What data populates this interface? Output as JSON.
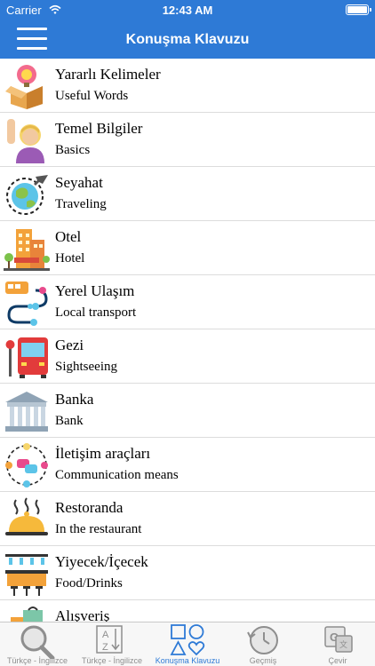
{
  "status_bar": {
    "carrier": "Carrier",
    "time": "12:43 AM"
  },
  "header": {
    "title": "Konuşma Klavuzu"
  },
  "categories": [
    {
      "title": "Yararlı Kelimeler",
      "subtitle": "Useful Words",
      "icon": "idea-box-icon"
    },
    {
      "title": "Temel Bilgiler",
      "subtitle": "Basics",
      "icon": "person-raising-hand-icon"
    },
    {
      "title": "Seyahat",
      "subtitle": "Traveling",
      "icon": "globe-airplane-icon"
    },
    {
      "title": "Otel",
      "subtitle": "Hotel",
      "icon": "hotel-building-icon"
    },
    {
      "title": "Yerel Ulaşım",
      "subtitle": "Local transport",
      "icon": "bus-route-icon"
    },
    {
      "title": "Gezi",
      "subtitle": "Sightseeing",
      "icon": "bus-stop-icon"
    },
    {
      "title": "Banka",
      "subtitle": "Bank",
      "icon": "bank-building-icon"
    },
    {
      "title": "İletişim araçları",
      "subtitle": "Communication means",
      "icon": "people-chat-icon"
    },
    {
      "title": "Restoranda",
      "subtitle": "In the restaurant",
      "icon": "food-cloche-icon"
    },
    {
      "title": "Yiyecek/İçecek",
      "subtitle": "Food/Drinks",
      "icon": "bar-counter-icon"
    },
    {
      "title": "Alışveriş",
      "subtitle": "",
      "icon": "shopping-bag-icon"
    }
  ],
  "tabs": [
    {
      "label": "Türkçe - İngilizce",
      "icon": "magnifier-icon"
    },
    {
      "label": "Türkçe - İngilizce",
      "icon": "sort-az-icon"
    },
    {
      "label": "Konuşma Klavuzu",
      "icon": "shapes-icon",
      "active": true
    },
    {
      "label": "Geçmiş",
      "icon": "history-clock-icon"
    },
    {
      "label": "Çevir",
      "icon": "translate-icon"
    }
  ],
  "colors": {
    "accent": "#2E7AD6",
    "tab_inactive": "#8E8E8E"
  }
}
